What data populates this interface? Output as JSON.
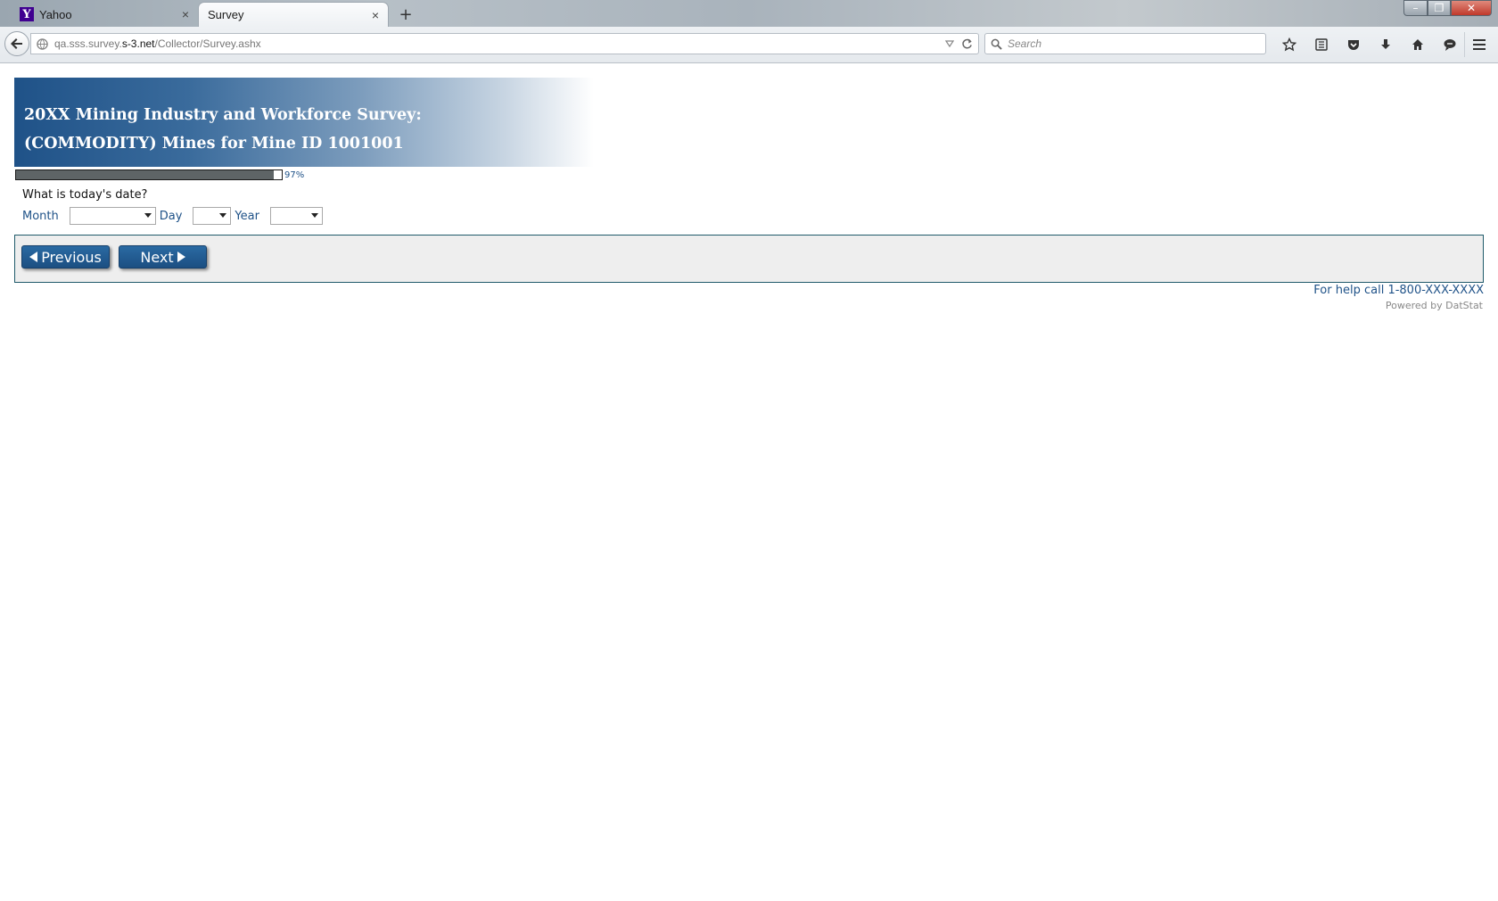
{
  "browser": {
    "tabs": [
      {
        "label": "Yahoo",
        "favicon": "Y",
        "active": false
      },
      {
        "label": "Survey",
        "active": true
      }
    ],
    "new_tab_symbol": "+",
    "close_symbol": "×",
    "url": {
      "prefix": "qa.sss.survey.",
      "host": "s-3.net",
      "path": "/Collector/Survey.ashx"
    },
    "search_placeholder": "Search",
    "window_controls": {
      "minimize": "–",
      "maximize": "❐",
      "close": "✕"
    },
    "toolbar_icons": [
      "star-icon",
      "reading-list-icon",
      "pocket-icon",
      "download-icon",
      "home-icon",
      "chat-icon"
    ]
  },
  "survey": {
    "title_line1": "20XX Mining Industry and Workforce Survey:",
    "title_line2": "(COMMODITY) Mines for Mine ID 1001001",
    "progress_label": "97%",
    "progress_value": 0.97,
    "question": "What is today's date?",
    "date_fields": {
      "month_label": "Month",
      "day_label": "Day",
      "year_label": "Year",
      "month_value": "",
      "day_value": "",
      "year_value": ""
    },
    "buttons": {
      "previous": "Previous",
      "next": "Next"
    },
    "help_text": "For help call 1-800-XXX-XXXX",
    "powered_by": "Powered by DatStat"
  },
  "colors": {
    "brand_blue": "#1f5288",
    "progress_fill": "#5e6466",
    "panel_bg": "#eeeeee"
  }
}
